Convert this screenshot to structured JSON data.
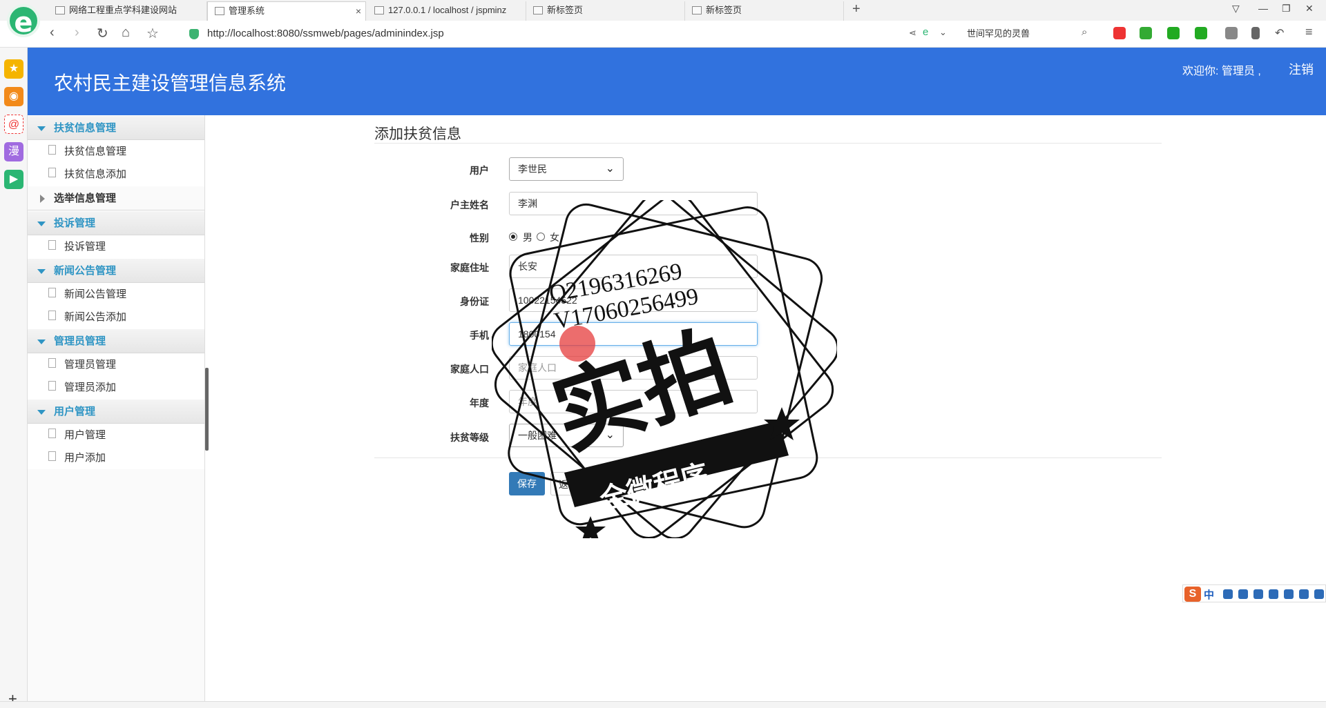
{
  "browser": {
    "logo": "e",
    "tabs": [
      {
        "label": "网络工程重点学科建设网站"
      },
      {
        "label": "管理系统",
        "close": "×"
      },
      {
        "label": "127.0.0.1 / localhost / jspminz"
      },
      {
        "label": "新标签页"
      },
      {
        "label": "新标签页"
      }
    ],
    "new_tab": "+",
    "url": "http://localhost:8080/ssmweb/pages/adminindex.jsp",
    "search_text": "世间罕见的灵兽"
  },
  "header": {
    "title": "农村民主建设管理信息系统",
    "welcome": "欢迎你: 管理员 ,",
    "logout": "注销"
  },
  "sidebar": {
    "groups": [
      {
        "label": "扶贫信息管理",
        "items": [
          {
            "label": "扶贫信息管理"
          },
          {
            "label": "扶贫信息添加"
          }
        ]
      },
      {
        "label": "选举信息管理",
        "items": []
      },
      {
        "label": "投诉管理",
        "items": [
          {
            "label": "投诉管理"
          }
        ]
      },
      {
        "label": "新闻公告管理",
        "items": [
          {
            "label": "新闻公告管理"
          },
          {
            "label": "新闻公告添加"
          }
        ]
      },
      {
        "label": "管理员管理",
        "items": [
          {
            "label": "管理员管理"
          },
          {
            "label": "管理员添加"
          }
        ]
      },
      {
        "label": "用户管理",
        "items": [
          {
            "label": "用户管理"
          },
          {
            "label": "用户添加"
          }
        ]
      }
    ]
  },
  "form": {
    "title": "添加扶贫信息",
    "fields": {
      "user": {
        "label": "用户",
        "value": "李世民"
      },
      "householder": {
        "label": "户主姓名",
        "value": "李渊"
      },
      "gender": {
        "label": "性别",
        "options": [
          "男",
          "女"
        ],
        "selected": "男"
      },
      "address": {
        "label": "家庭住址",
        "value": "长安"
      },
      "idcard": {
        "label": "身份证",
        "value": "10022154522"
      },
      "phone": {
        "label": "手机",
        "value": "1800154"
      },
      "population": {
        "label": "家庭人口",
        "placeholder": "家庭人口"
      },
      "year": {
        "label": "年度",
        "placeholder": "年度"
      },
      "level": {
        "label": "扶贫等级",
        "value": "一般困难"
      }
    },
    "save": "保存",
    "back": "返回"
  },
  "watermark": {
    "line1": "Q2196316269",
    "line2": "V17060256499",
    "main": "实拍",
    "banner": "全微程序"
  },
  "ime": {
    "brand": "S",
    "mode": "中"
  }
}
